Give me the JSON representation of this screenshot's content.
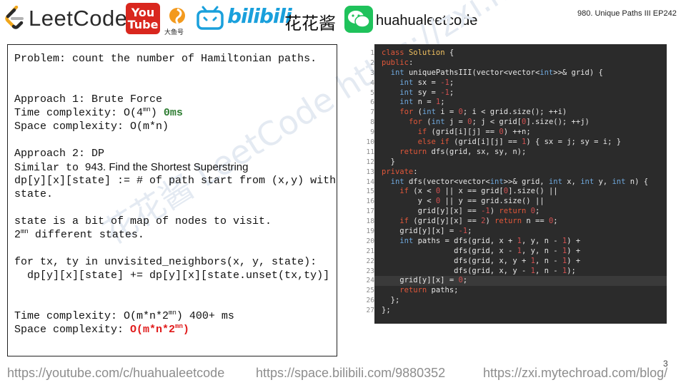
{
  "header": {
    "logo_text": "LeetCode",
    "youtube_line1": "You",
    "youtube_line2": "Tube",
    "dayu_label": "大鱼号",
    "bilibili_text": "bilibili",
    "channel_cn": "花花酱",
    "wechat_id": "huahualeetcode",
    "episode": "980. Unique Paths III EP242"
  },
  "notes": {
    "line_problem": "Problem: count the number of Hamiltonian paths.",
    "approach1_title": "Approach 1: Brute Force",
    "a1_time_prefix": "Time complexity: O(4",
    "a1_time_sup": "mn",
    "a1_time_suffix": ") ",
    "a1_time_result": "0ms",
    "a1_space": "Space complexity: O(m*n)",
    "approach2_title": "Approach 2: DP",
    "similar_prefix": "Similar to ",
    "similar_link": "943. Find the Shortest Superstring",
    "dp_def_1": "dp[y][x][state] := # of path start from (x,y) with",
    "dp_def_2": "state.",
    "state_desc": "state is a bit of map of nodes to visit.",
    "states_prefix": "2",
    "states_sup": "mn",
    "states_suffix": " different states.",
    "loop_1": "for tx, ty in unvisited_neighbors(x, y, state):",
    "loop_2": "  dp[y][x][state] += dp[y][x][state.unset(tx,ty)]",
    "a2_time_prefix": "Time complexity: O(m*n*2",
    "a2_time_sup": "mn",
    "a2_time_suffix": ") 400+ ms",
    "a2_space_prefix": "Space complexity: ",
    "a2_space_red_1": "O(m*n*2",
    "a2_space_sup": "mn",
    "a2_space_red_2": ")"
  },
  "code": {
    "line_numbers": [
      "1",
      "2",
      "3",
      "4",
      "5",
      "6",
      "7",
      "8",
      "9",
      "10",
      "11",
      "12",
      "13",
      "14",
      "15",
      "16",
      "17",
      "18",
      "19",
      "20",
      "21",
      "22",
      "23",
      "24",
      "25",
      "26",
      "27"
    ],
    "highlight_line": 24
  },
  "watermark": "花花酱 LeetCode https://zxi.mytechroad.com",
  "footer": {
    "youtube": "https://youtube.com/c/huahualeetcode",
    "bilibili": "https://space.bilibili.com/9880352",
    "blog": "https://zxi.mytechroad.com/blog/",
    "page_number": "3"
  },
  "colors": {
    "code_bg": "#2b2b2b",
    "keyword": "#e0573a",
    "type": "#6fa8dc",
    "number": "#d05050",
    "class_name": "#f0c060",
    "green_result": "#2e7d32",
    "red_result": "#e01b1b",
    "youtube_red": "#d9271e",
    "bilibili_blue": "#1aa0dc",
    "wechat_green": "#1fc25b"
  }
}
